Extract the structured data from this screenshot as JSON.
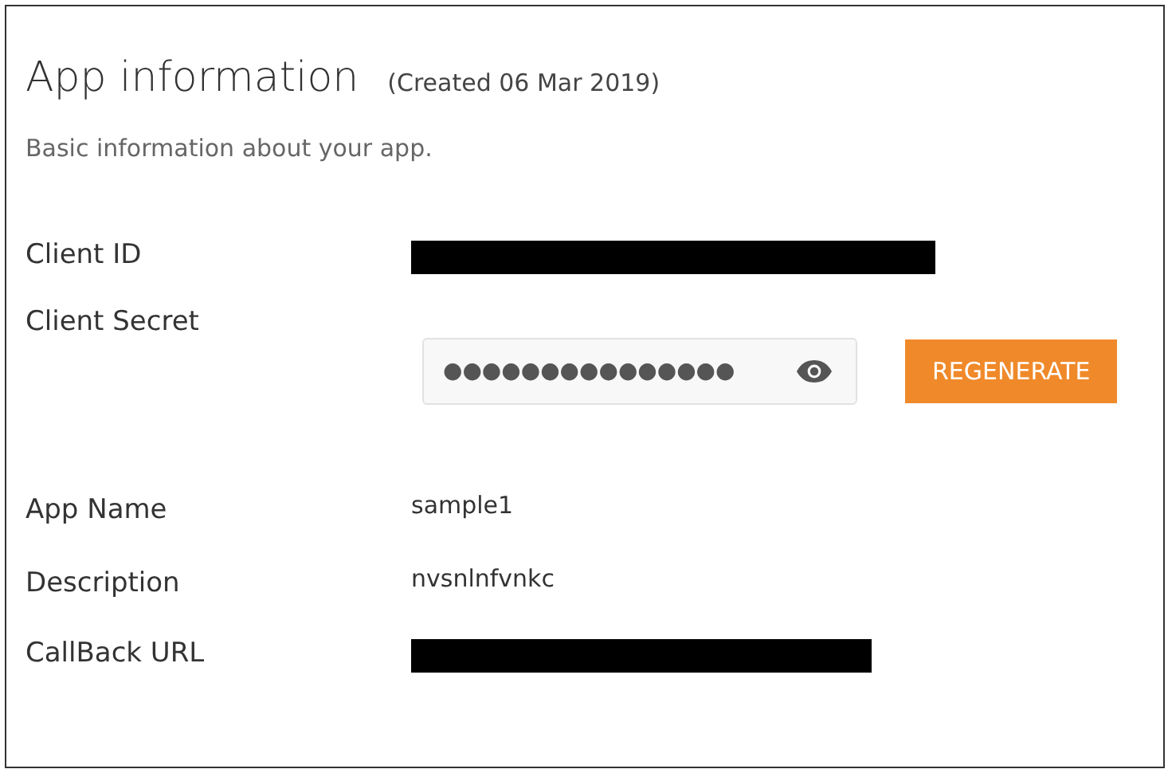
{
  "header": {
    "title": "App information",
    "created": "(Created 06 Mar 2019)",
    "subtitle": "Basic information about your app."
  },
  "fields": [
    {
      "label": "Client ID",
      "kind": "redacted"
    },
    {
      "label": "Client Secret",
      "kind": "secret",
      "value": "●●●●●●●●●●●●●●●",
      "button": "REGENERATE"
    },
    {
      "label": "App Name",
      "kind": "text",
      "value": "sample1"
    },
    {
      "label": "Description",
      "kind": "text",
      "value": "nvsnlnfvnkc"
    },
    {
      "label": "CallBack URL",
      "kind": "redacted"
    }
  ]
}
